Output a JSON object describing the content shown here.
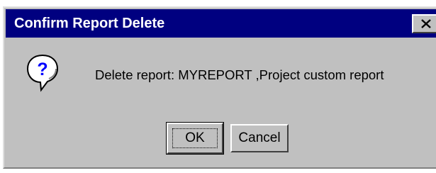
{
  "dialog": {
    "title": "Confirm Report Delete",
    "close_glyph": "✕",
    "icon": "question-icon",
    "message": "Delete report: MYREPORT ,Project custom report",
    "ok_label": "OK",
    "cancel_label": "Cancel"
  },
  "colors": {
    "title_bar": "#000080",
    "face": "#c0c0c0",
    "icon_bubble": "#ffffff",
    "icon_mark": "#0000ff"
  }
}
